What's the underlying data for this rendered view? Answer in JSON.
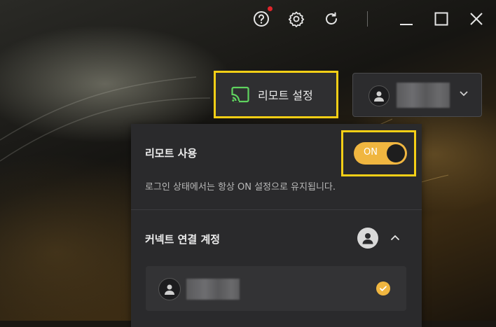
{
  "titlebar": {
    "icons": [
      "help-icon",
      "settings-icon",
      "refresh-icon",
      "minimize-icon",
      "maximize-icon",
      "close-icon"
    ],
    "notification_color": "#e0252b"
  },
  "remote_button": {
    "label": "리모트 설정",
    "icon": "cast-icon",
    "highlight_color": "#f5cf16"
  },
  "account_button": {
    "icon": "user-icon",
    "dropdown_icon": "chevron-down-icon"
  },
  "panel": {
    "remote_use": {
      "title": "리모트 사용",
      "toggle_label": "ON",
      "toggle_on": true,
      "toggle_color": "#f0b640",
      "description": "로그인 상태에서는 항상 ON 설정으로 유지됩니다."
    },
    "connect_accounts": {
      "title": "커넥트 연결 계정",
      "icon": "user-icon",
      "collapse_icon": "chevron-up-icon",
      "accounts": [
        {
          "selected": true
        }
      ]
    }
  }
}
